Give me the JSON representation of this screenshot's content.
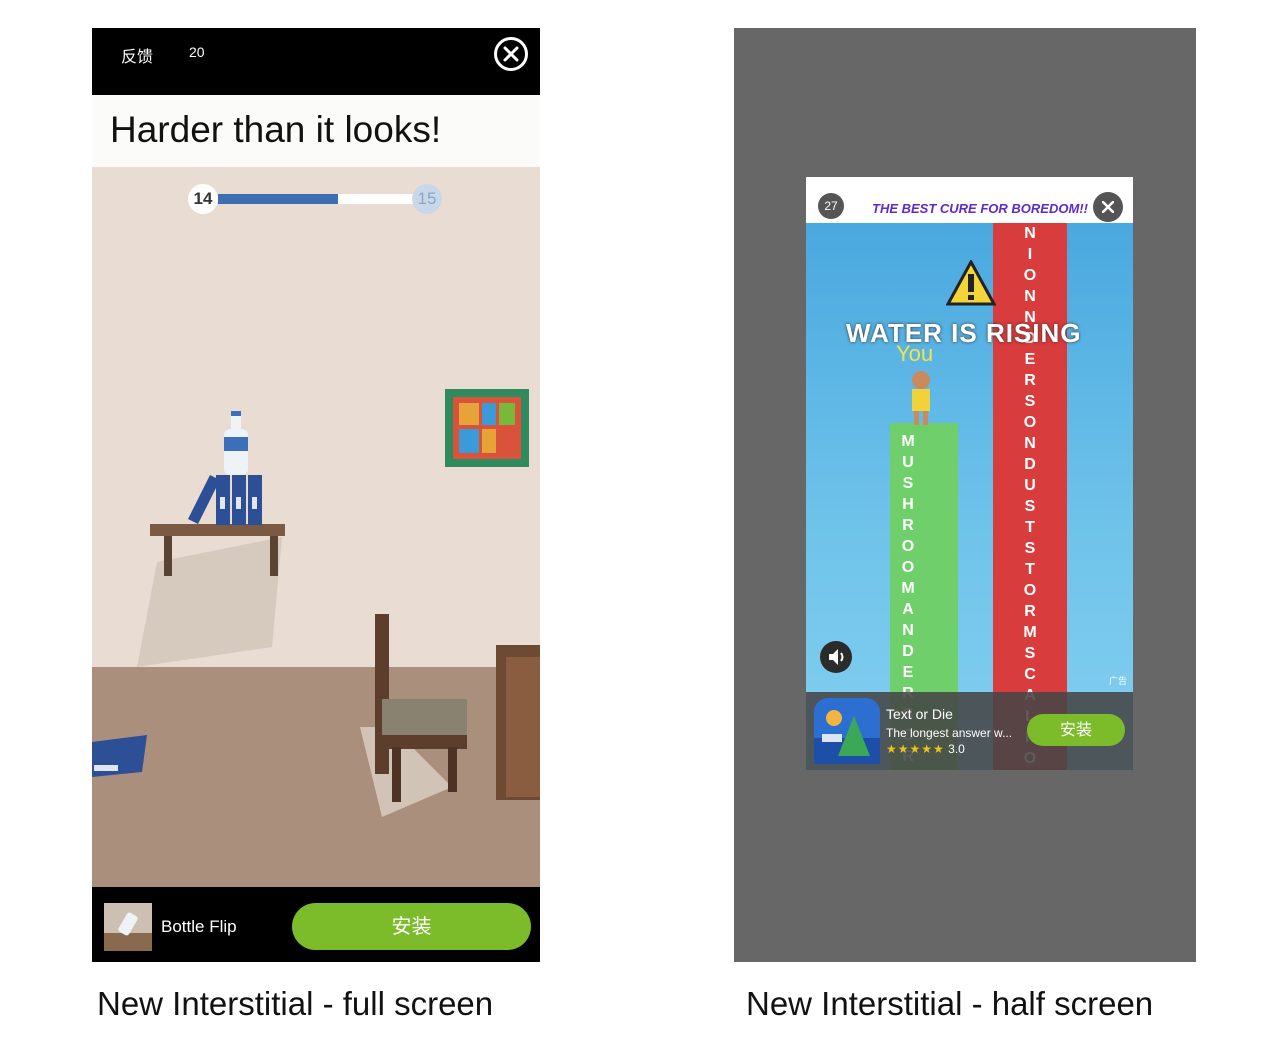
{
  "full_screen": {
    "feedback_label": "反馈",
    "countdown": "20",
    "headline": "Harder than it looks!",
    "level_current": "14",
    "level_next": "15",
    "level_progress": 0.61,
    "app_name": "Bottle Flip",
    "install_label": "安装",
    "install_color": "#7cbc2b",
    "close_icon": "close-circle-icon"
  },
  "half_screen": {
    "countdown": "27",
    "tagline": "THE BEST CURE FOR BOREDOM!!",
    "video_banner": "WATER IS RISING",
    "player_label": "You",
    "red_tower_letters": "NIONNDERSONDUSTSTORMSCALFO",
    "green_tower_letters": "MUSHROOMANDERSOR",
    "ad_badge": "广告",
    "app_name": "Text or Die",
    "app_desc": "The longest answer w...",
    "app_stars": "★★★★★",
    "app_rating": "3.0",
    "install_label": "安装",
    "backdrop_color": "#676767",
    "tagline_color": "#5b2ad0"
  },
  "captions": {
    "left": "New Interstitial - full screen",
    "right": "New Interstitial - half screen"
  }
}
